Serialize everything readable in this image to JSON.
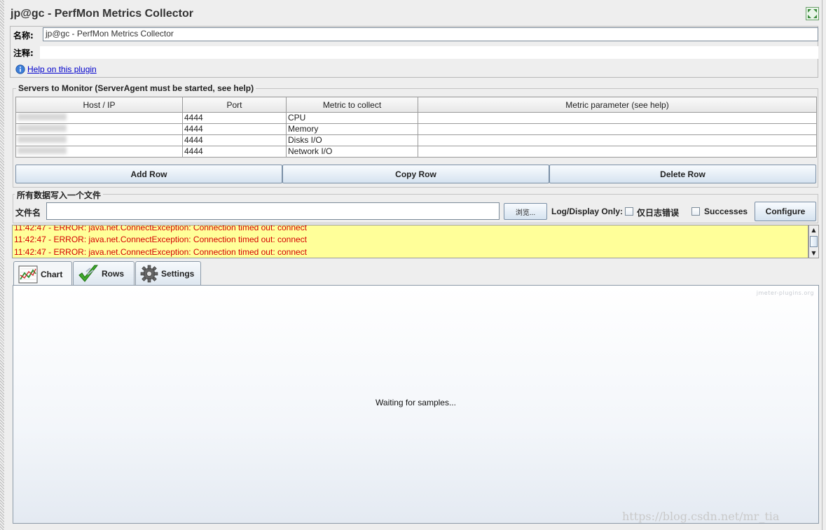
{
  "window": {
    "title": "jp@gc - PerfMon Metrics Collector"
  },
  "name_panel": {
    "name_label": "名称:",
    "name_value": "jp@gc - PerfMon Metrics Collector",
    "comment_label": "注释:",
    "comment_value": "",
    "help_link": "Help on this plugin"
  },
  "servers": {
    "group_title": "Servers to Monitor (ServerAgent must be started, see help)",
    "columns": [
      "Host / IP",
      "Port",
      "Metric to collect",
      "Metric parameter (see help)"
    ],
    "rows": [
      {
        "host": "",
        "port": "4444",
        "metric": "CPU",
        "param": ""
      },
      {
        "host": "",
        "port": "4444",
        "metric": "Memory",
        "param": ""
      },
      {
        "host": "",
        "port": "4444",
        "metric": "Disks I/O",
        "param": ""
      },
      {
        "host": "",
        "port": "4444",
        "metric": "Network I/O",
        "param": ""
      }
    ],
    "buttons": {
      "add": "Add Row",
      "copy": "Copy Row",
      "delete": "Delete Row"
    }
  },
  "file_panel": {
    "group_title": "所有数据写入一个文件",
    "filename_label": "文件名",
    "filename_value": "",
    "browse": "浏览...",
    "log_display_label": "Log/Display Only:",
    "errors_only": "仅日志错误",
    "successes": "Successes",
    "configure": "Configure"
  },
  "log": {
    "lines": [
      "11:42:47 - ERROR: java.net.ConnectException: Connection timed out: connect",
      "11:42:47 - ERROR: java.net.ConnectException: Connection timed out: connect",
      "11:42:47 - ERROR: java.net.ConnectException: Connection timed out: connect"
    ]
  },
  "tabs": [
    {
      "label": "Chart",
      "icon": "chart-icon",
      "active": true
    },
    {
      "label": "Rows",
      "icon": "checkmark-icon",
      "active": false
    },
    {
      "label": "Settings",
      "icon": "gear-icon",
      "active": false
    }
  ],
  "chart": {
    "status": "Waiting for samples...",
    "brand": "jmeter-plugins.org"
  },
  "watermark": "https://blog.csdn.net/mr_tia"
}
